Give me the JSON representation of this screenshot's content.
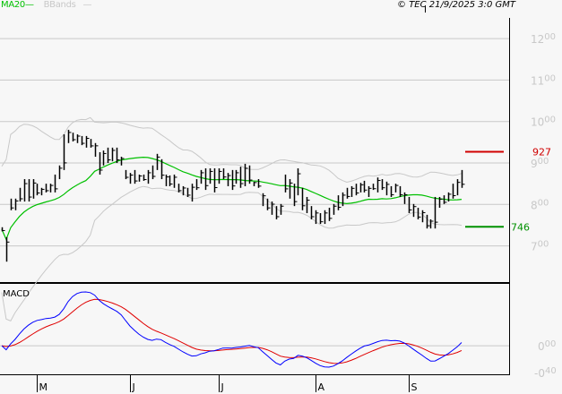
{
  "legend": {
    "ma_label": "MA20",
    "bb_label": "BBands"
  },
  "copyright": "© TEC 21/9/2025 3:0 GMT",
  "colors": {
    "ma": "#00c000",
    "bands": "#c8c8c8",
    "macd": "#0000ff",
    "signal": "#e00000",
    "ref_high": "#d00000",
    "ref_low": "#009000"
  },
  "chart_data": {
    "type": "ohlc",
    "title": "",
    "ylim": [
      640,
      1240
    ],
    "y_ticks": [
      {
        "v": 1200,
        "main": "12",
        "sup": "00"
      },
      {
        "v": 1100,
        "main": "11",
        "sup": "00"
      },
      {
        "v": 1000,
        "main": "10",
        "sup": "00"
      },
      {
        "v": 900,
        "main": "9",
        "sup": "00"
      },
      {
        "v": 800,
        "main": "8",
        "sup": "00"
      },
      {
        "v": 700,
        "main": "7",
        "sup": "00"
      }
    ],
    "x_ticks": [
      {
        "label": "M",
        "bar": 8
      },
      {
        "label": "J",
        "bar": 29
      },
      {
        "label": "J",
        "bar": 49
      },
      {
        "label": "A",
        "bar": 71
      },
      {
        "label": "S",
        "bar": 92
      }
    ],
    "ref_lines": [
      {
        "value": 927,
        "label": "927",
        "color": "#d00000"
      },
      {
        "value": 746,
        "label": "746",
        "color": "#009000"
      }
    ],
    "indicators": [
      "MA20",
      "BBands"
    ],
    "bars": [
      [
        745,
        735
      ],
      [
        721,
        662
      ],
      [
        814,
        786
      ],
      [
        814,
        786
      ],
      [
        840,
        807
      ],
      [
        861,
        807
      ],
      [
        861,
        807
      ],
      [
        861,
        814
      ],
      [
        850,
        822
      ],
      [
        840,
        822
      ],
      [
        850,
        829
      ],
      [
        850,
        829
      ],
      [
        872,
        829
      ],
      [
        894,
        861
      ],
      [
        969,
        883
      ],
      [
        980,
        948
      ],
      [
        973,
        952
      ],
      [
        969,
        948
      ],
      [
        965,
        943
      ],
      [
        965,
        937
      ],
      [
        958,
        937
      ],
      [
        948,
        915
      ],
      [
        926,
        872
      ],
      [
        930,
        894
      ],
      [
        937,
        900
      ],
      [
        937,
        904
      ],
      [
        937,
        900
      ],
      [
        915,
        894
      ],
      [
        883,
        861
      ],
      [
        876,
        850
      ],
      [
        883,
        850
      ],
      [
        872,
        855
      ],
      [
        872,
        857
      ],
      [
        883,
        850
      ],
      [
        894,
        861
      ],
      [
        922,
        883
      ],
      [
        909,
        861
      ],
      [
        872,
        844
      ],
      [
        870,
        844
      ],
      [
        872,
        840
      ],
      [
        850,
        829
      ],
      [
        844,
        822
      ],
      [
        840,
        818
      ],
      [
        850,
        807
      ],
      [
        861,
        835
      ],
      [
        883,
        850
      ],
      [
        887,
        835
      ],
      [
        887,
        850
      ],
      [
        887,
        829
      ],
      [
        887,
        850
      ],
      [
        887,
        861
      ],
      [
        876,
        844
      ],
      [
        883,
        835
      ],
      [
        883,
        850
      ],
      [
        891,
        840
      ],
      [
        898,
        844
      ],
      [
        894,
        850
      ],
      [
        855,
        844
      ],
      [
        861,
        840
      ],
      [
        827,
        796
      ],
      [
        814,
        786
      ],
      [
        807,
        775
      ],
      [
        796,
        764
      ],
      [
        801,
        775
      ],
      [
        872,
        829
      ],
      [
        861,
        814
      ],
      [
        850,
        796
      ],
      [
        887,
        822
      ],
      [
        840,
        786
      ],
      [
        818,
        779
      ],
      [
        796,
        764
      ],
      [
        786,
        753
      ],
      [
        779,
        753
      ],
      [
        786,
        753
      ],
      [
        792,
        760
      ],
      [
        801,
        775
      ],
      [
        822,
        786
      ],
      [
        829,
        796
      ],
      [
        840,
        814
      ],
      [
        844,
        818
      ],
      [
        850,
        822
      ],
      [
        852,
        829
      ],
      [
        857,
        829
      ],
      [
        844,
        818
      ],
      [
        850,
        835
      ],
      [
        865,
        829
      ],
      [
        861,
        835
      ],
      [
        855,
        822
      ],
      [
        844,
        818
      ],
      [
        850,
        829
      ],
      [
        844,
        818
      ],
      [
        829,
        801
      ],
      [
        818,
        779
      ],
      [
        801,
        770
      ],
      [
        792,
        764
      ],
      [
        786,
        757
      ],
      [
        775,
        742
      ],
      [
        764,
        742
      ],
      [
        818,
        742
      ],
      [
        818,
        792
      ],
      [
        822,
        801
      ],
      [
        829,
        807
      ],
      [
        850,
        814
      ],
      [
        861,
        822
      ],
      [
        883,
        840
      ]
    ],
    "macd": {
      "label": "MACD",
      "ticks": [
        {
          "v": 0,
          "main": "0",
          "sup": "00"
        },
        {
          "v": -0.4,
          "main": "-0",
          "sup": "40"
        }
      ]
    }
  }
}
